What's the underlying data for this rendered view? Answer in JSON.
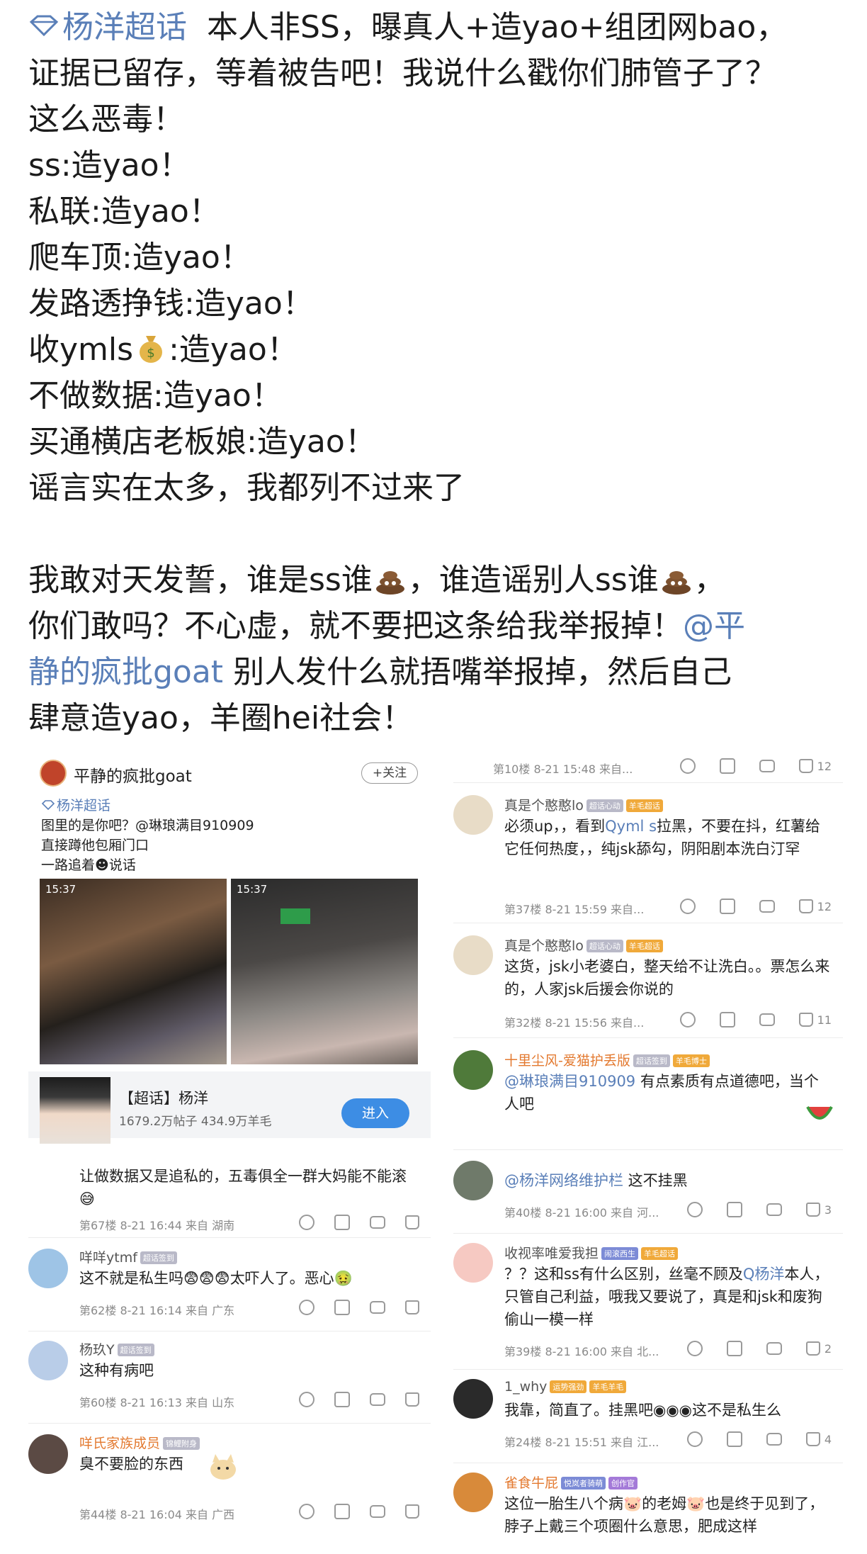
{
  "post": {
    "tag": "杨洋超话",
    "line1_rest": "本人非SS，曝真人+造yao+组团网bao，",
    "line2": "证据已留存，等着被告吧！我说什么戳你们肺管子了？",
    "line3": "这么恶毒！",
    "items": [
      "ss:造yao！",
      "私联:造yao！",
      "爬车顶:造yao！",
      "发路透挣钱:造yao！",
      "收ymls",
      "不做数据:造yao！",
      "买通横店老板娘:造yao！",
      "谣言实在太多，我都列不过来了"
    ],
    "item5_suffix": ":造yao！",
    "para2_line1_a": "我敢对天发誓，谁是ss谁",
    "para2_line1_b": "，谁造谣别人ss谁",
    "para2_line1_c": "，",
    "para2_line2_a": "你们敢吗？不心虚，就不要把这条给我举报掉！",
    "para2_line2_mention": "@平",
    "para2_line3_mention": "静的疯批goat",
    "para2_line3_rest": " 别人发什么就捂嘴举报掉，然后自己",
    "para2_line4": "肆意造yao，羊圈hei社会！"
  },
  "card": {
    "username": "平静的疯批goat",
    "follow": "+关注",
    "tag": "杨洋超话",
    "text1": "图里的是你吧？@琳琅满目910909",
    "text2": "直接蹲他包厢门口",
    "text3": "一路追着",
    "text3_b": "说话",
    "img_time": "15:37",
    "group_name": "【超话】杨洋",
    "group_stats": "1679.2万帖子 434.9万羊毛",
    "enter": "进入"
  },
  "right_comments": [
    {
      "name": "",
      "body": "",
      "meta": "第10楼 8-21 15:48 来自...",
      "likes": "12",
      "avatar": "#f3d8e8"
    },
    {
      "name": "真是个憨憨lo",
      "badges": [
        "超话心动",
        "羊毛超话"
      ],
      "body_parts": [
        "必须up，，看到",
        "Qyml s",
        "拉黑，不要在抖，红薯给它任何热度，，纯jsk舔勾，阴阳剧本洗白汀罕"
      ],
      "meta": "第37楼 8-21 15:59 来自...",
      "likes": "12",
      "avatar": "#e8dcc7"
    },
    {
      "name": "真是个憨憨lo",
      "badges": [
        "超话心动",
        "羊毛超话"
      ],
      "body": "这货，jsk小老婆白，整天给不让洗白。。票怎么来的，人家jsk后援会你说的",
      "meta": "第32楼 8-21 15:56 来自...",
      "likes": "11",
      "avatar": "#e8dcc7"
    },
    {
      "name": "十里尘风-爱猫护丢版",
      "badges": [
        "超话签到",
        "羊毛博士"
      ],
      "body_mention": "@琳琅满目910909",
      "body": " 有点素质有点道德吧，当个人吧",
      "meta": "",
      "likes": "",
      "avatar": "#4f7a3a"
    },
    {
      "name": "",
      "body_mention": "@杨洋网络维护栏",
      "body": " 这不挂黑",
      "meta": "第40楼 8-21 16:00 来自 河...",
      "likes": "3",
      "avatar": "#6f7a6a"
    },
    {
      "name": "收视率唯爱我担",
      "badges": [
        "闹滚西生",
        "羊毛超话"
      ],
      "body": "？？这和ss有什么区别，丝毫不顾及",
      "body_mention": "Q杨洋",
      "body_tail": "本人，只管自己利益，哦我又要说了，真是和jsk和废狗偷山一模一样",
      "meta": "第39楼 8-21 16:00 来自 北...",
      "likes": "2",
      "avatar": "#f6c9c2"
    },
    {
      "name": "1_why",
      "badges": [
        "运势强劲",
        "羊毛羊毛"
      ],
      "body": "我靠，简直了。挂黑吧",
      "body_tail": "这不是私生么",
      "meta": "第24楼 8-21 15:51 来自 江...",
      "likes": "4",
      "avatar": "#2a2a2a"
    },
    {
      "name": "雀食牛屁",
      "badges": [
        "悦岚者骑萌",
        "创作官"
      ],
      "body": "这位一胎生八个病",
      "body_b": "的老姆",
      "body_c": "也是终于见到了，脖子上戴三个项圈什么意思，肥成这样",
      "meta": "",
      "likes": "",
      "avatar": "#d88a3a"
    }
  ],
  "left_comments": [
    {
      "name": "",
      "body": "让做数据又是追私的，五毒俱全一群大妈能不能滚",
      "meta": "第67楼 8-21 16:44 来自 湖南",
      "avatar": "#cfc7c2"
    },
    {
      "name": "咩咩ytmf",
      "badges": [
        "超话签到"
      ],
      "body": "这不就是私生吗",
      "body_tail": "太吓人了。恶心",
      "meta": "第62楼 8-21 16:14 来自 广东",
      "avatar": "#9ec4e6"
    },
    {
      "name": "杨玖Y",
      "badges": [
        "超话签到"
      ],
      "body": "这种有病吧",
      "meta": "第60楼 8-21 16:13 来自 山东",
      "avatar": "#b9cde8"
    },
    {
      "name": "咩氏家族成员",
      "badges": [
        "锦鲤附身"
      ],
      "body": "臭不要脸的东西",
      "meta": "第44楼 8-21 16:04 来自 广西",
      "avatar": "#5b4a44"
    }
  ],
  "colors": {
    "mention": "#5a7fb8",
    "accent_orange": "#e3792f",
    "enter_button": "#3d8de4"
  }
}
